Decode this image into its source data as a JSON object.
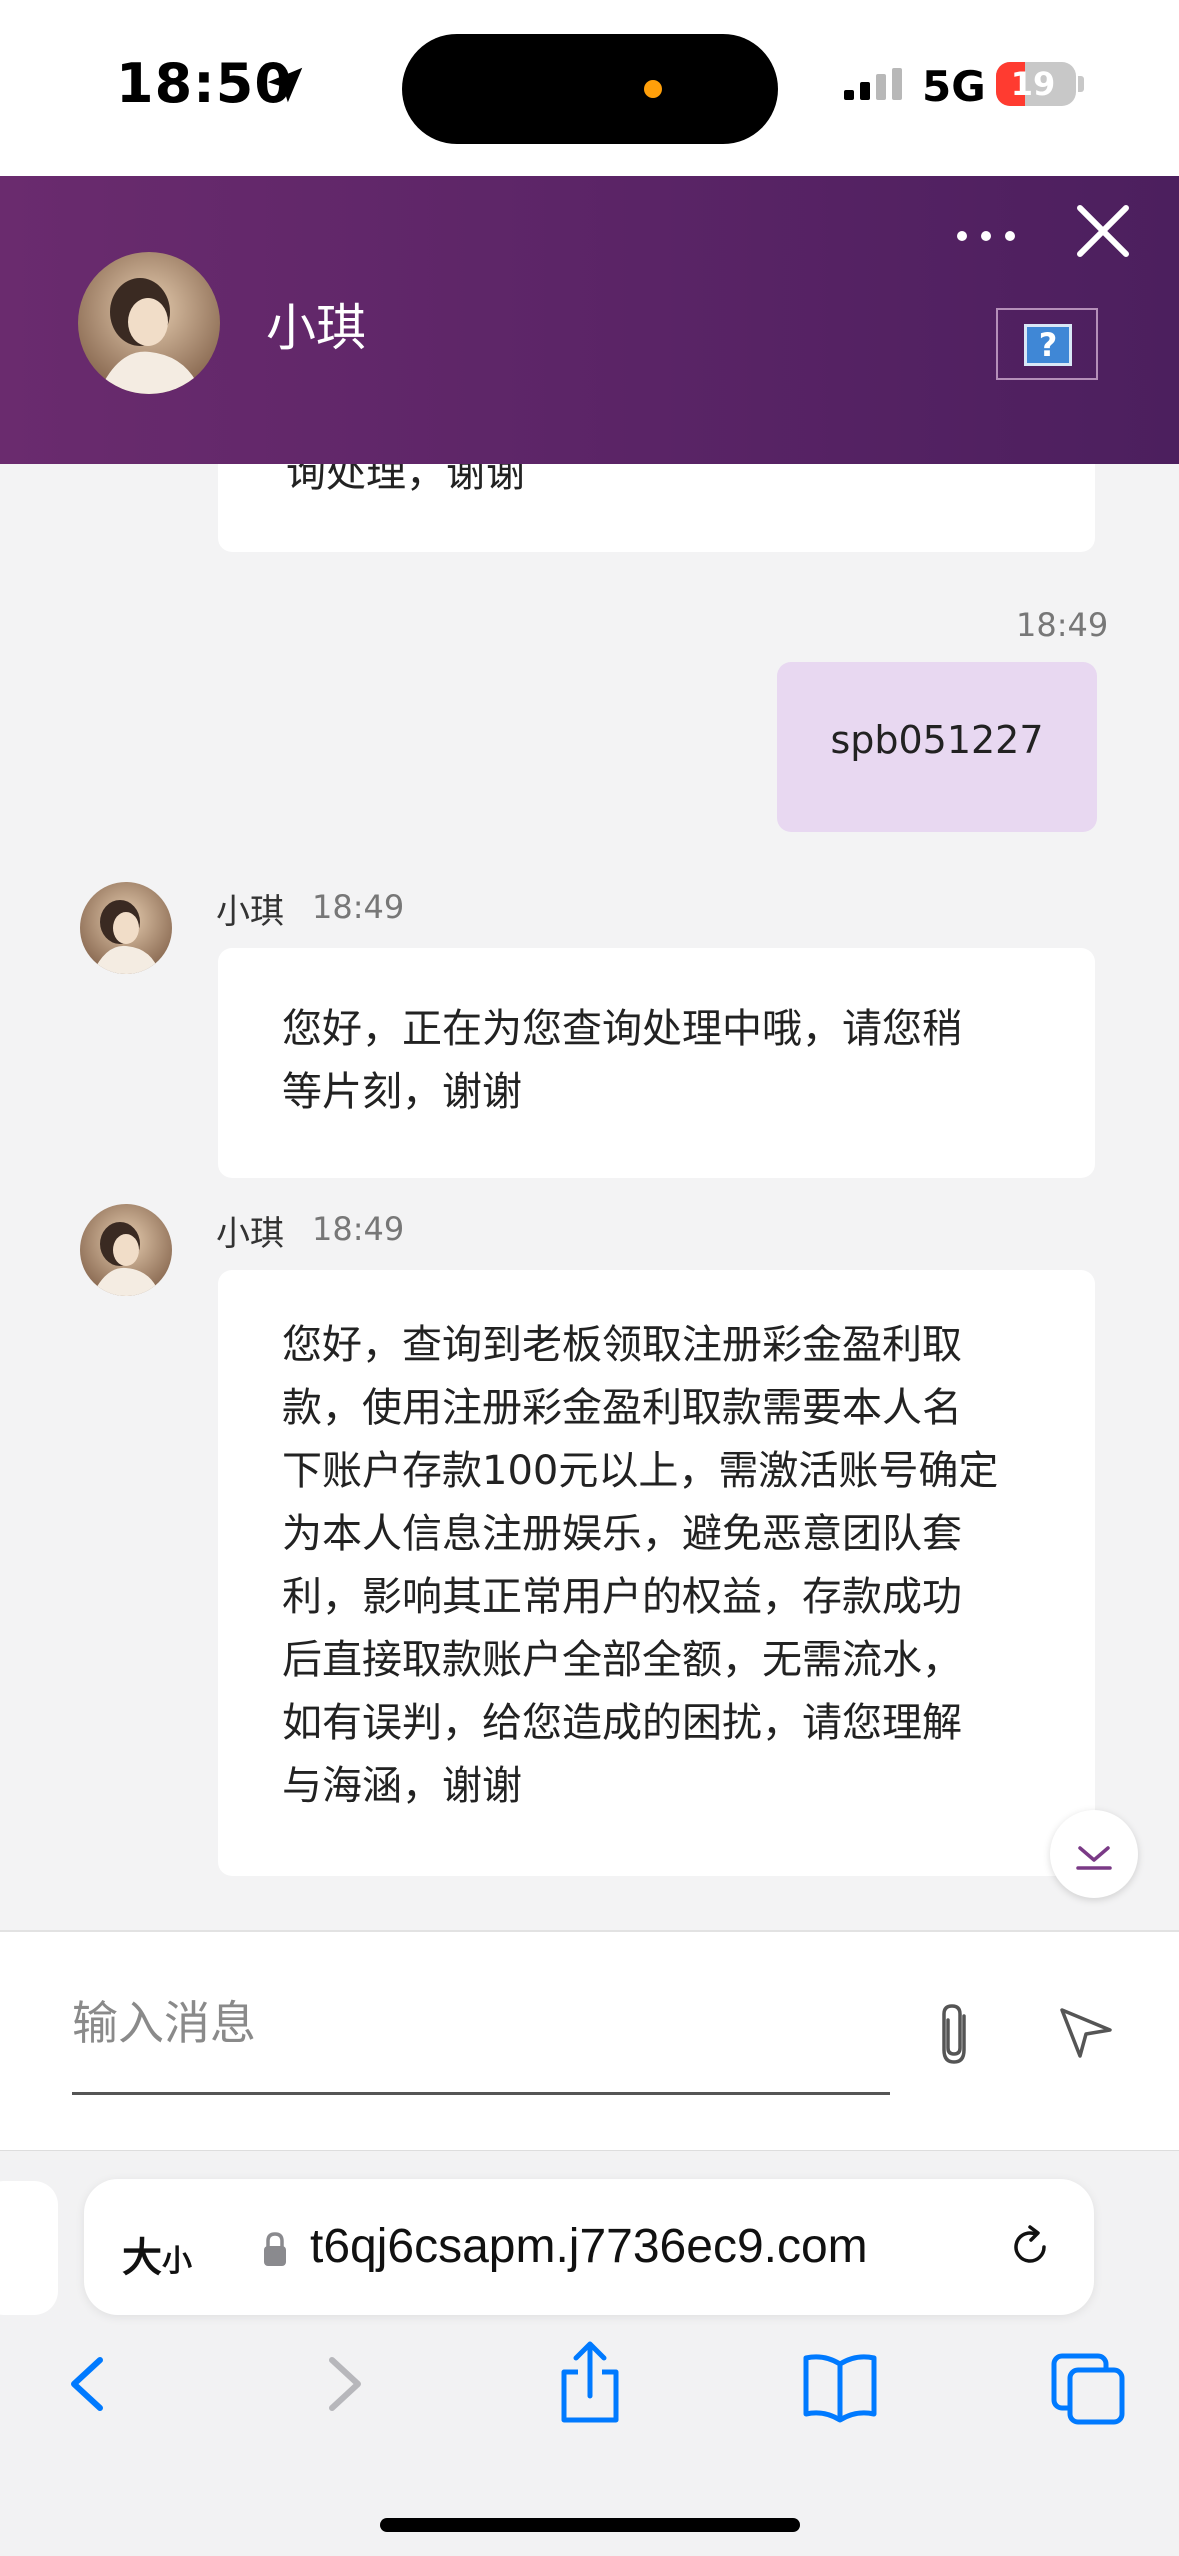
{
  "status_bar": {
    "time": "18:50",
    "network": "5G",
    "battery": "19",
    "battery_level": 0.19,
    "icons": [
      "location-arrow-icon",
      "cellular-signal-icon"
    ]
  },
  "header": {
    "agent_name": "小琪",
    "icons": [
      "more-icon",
      "close-icon",
      "help-icon"
    ],
    "help_glyph": "?",
    "colors": {
      "gradient_start": "#6a2b6e",
      "gradient_end": "#4c1f5e"
    }
  },
  "messages": [
    {
      "type": "incoming_partial",
      "text": "询处理，谢谢"
    },
    {
      "type": "outgoing",
      "time": "18:49",
      "text": "spb051227"
    },
    {
      "type": "incoming",
      "sender": "小琪",
      "time": "18:49",
      "lines": [
        "您好，正在为您查询处理中哦，请您稍",
        "等片刻，谢谢"
      ]
    },
    {
      "type": "incoming",
      "sender": "小琪",
      "time": "18:49",
      "lines": [
        "您好，查询到老板领取注册彩金盈利取",
        "款，使用注册彩金盈利取款需要本人名",
        "下账户存款100元以上，需激活账号确定",
        "为本人信息注册娱乐，避免恶意团队套",
        "利，影响其正常用户的权益，存款成功",
        "后直接取款账户全部全额，无需流水，",
        "如有误判，给您造成的困扰，请您理解",
        "与海涵，谢谢"
      ]
    }
  ],
  "input": {
    "placeholder": "输入消息",
    "value": ""
  },
  "browser": {
    "size_label": "大",
    "size_label_small": "小",
    "url": "t6qj6csapm.j7736ec9.com",
    "nav_icons": [
      "back-icon",
      "forward-icon",
      "share-icon",
      "bookmarks-icon",
      "tabs-icon"
    ],
    "accent": "#007aff"
  }
}
